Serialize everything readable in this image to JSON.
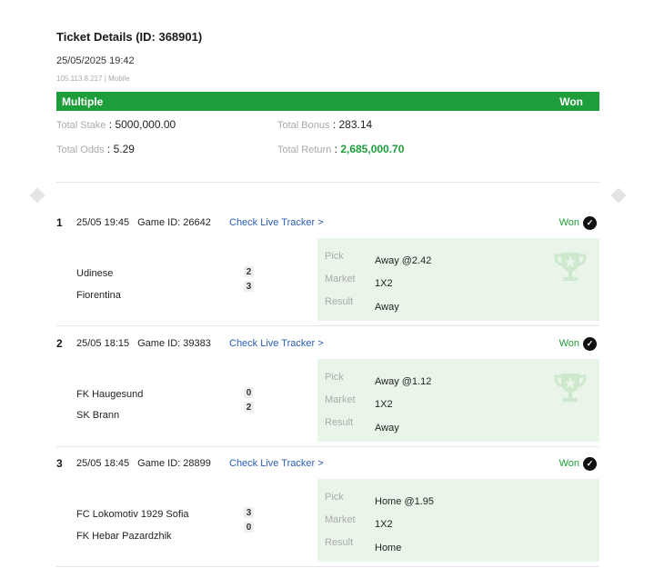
{
  "ticket": {
    "title": "Ticket Details (ID: 368901)",
    "datetime": "25/05/2025 19:42",
    "ip_line": "105.113.8.217 | Mobile"
  },
  "banner": {
    "type": "Multiple",
    "status": "Won"
  },
  "stats": {
    "total_stake_label": "Total Stake",
    "total_stake_value": "5000,000.00",
    "total_bonus_label": "Total Bonus",
    "total_bonus_value": "283.14",
    "total_odds_label": "Total Odds",
    "total_odds_value": "5.29",
    "total_return_label": "Total Return",
    "total_return_value": "2,685,000.70"
  },
  "labels": {
    "live_tracker": "Check Live Tracker >",
    "pick": "Pick",
    "market": "Market",
    "result": "Result"
  },
  "legs": [
    {
      "num": "1",
      "time": "25/05 19:45",
      "game": "Game ID: 26642",
      "status": "Won",
      "home": "Udinese",
      "away": "Fiorentina",
      "home_score": "2",
      "away_score": "3",
      "pick": "Away @2.42",
      "market": "1X2",
      "result": "Away"
    },
    {
      "num": "2",
      "time": "25/05 18:15",
      "game": "Game ID: 39383",
      "status": "Won",
      "home": "FK Haugesund",
      "away": "SK Brann",
      "home_score": "0",
      "away_score": "2",
      "pick": "Away @1.12",
      "market": "1X2",
      "result": "Away"
    },
    {
      "num": "3",
      "time": "25/05 18:45",
      "game": "Game ID: 28899",
      "status": "Won",
      "home": "FC Lokomotiv 1929 Sofia",
      "away": "FK Hebar Pazardzhik",
      "home_score": "3",
      "away_score": "0",
      "pick": "Home @1.95",
      "market": "1X2",
      "result": "Home"
    }
  ],
  "colors": {
    "accent_green": "#1e9e3a",
    "pick_bg": "#eaf5ea",
    "link_blue": "#2a5db0"
  }
}
